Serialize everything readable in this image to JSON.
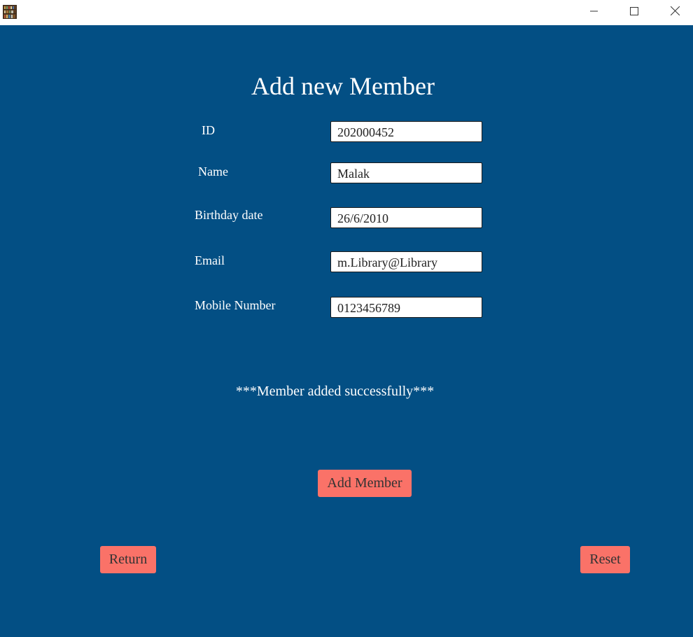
{
  "titlebar": {
    "app_icon": "bookshelf-icon",
    "controls": {
      "minimize": "minimize-icon",
      "maximize": "maximize-icon",
      "close": "close-icon"
    }
  },
  "form": {
    "title": "Add new Member",
    "fields": {
      "id": {
        "label": "ID",
        "value": "202000452"
      },
      "name": {
        "label": "Name",
        "value": "Malak"
      },
      "birthday": {
        "label": "Birthday date",
        "value": "26/6/2010"
      },
      "email": {
        "label": "Email",
        "value": "m.Library@Library"
      },
      "mobile": {
        "label": "Mobile Number",
        "value": "0123456789"
      }
    },
    "status_message": "***Member added successfully***",
    "add_button": "Add Member",
    "return_button": "Return",
    "reset_button": "Reset"
  },
  "colors": {
    "background": "#034f84",
    "button": "#fa7268",
    "text": "#ffffff"
  }
}
